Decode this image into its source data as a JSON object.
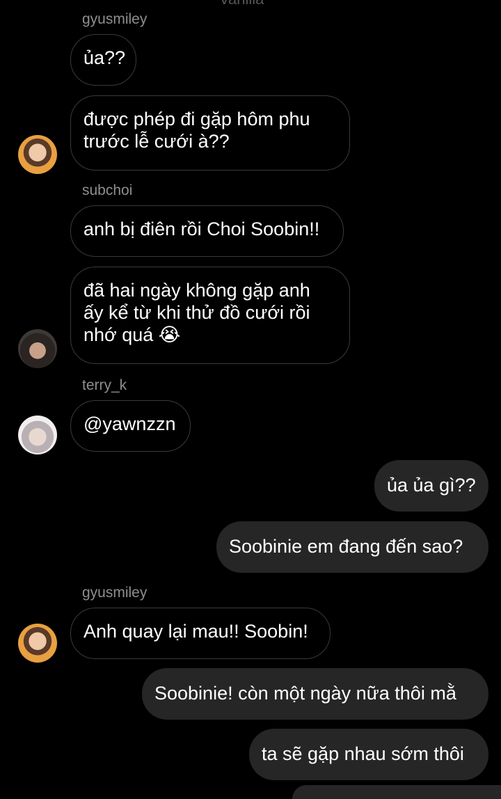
{
  "header_partial": "Vanilla",
  "messages": [
    {
      "username": "gyusmiley"
    },
    {
      "text": "ủa??"
    },
    {
      "text": "được phép đi gặp hôm phu\ntrước lễ cưới à??"
    },
    {
      "username": "subchoi"
    },
    {
      "text": "anh bị điên rồi Choi Soobin!!"
    },
    {
      "text": "đã hai ngày không gặp anh\nấy kể từ khi thử đồ cưới rồi\nnhớ quá 😭"
    },
    {
      "username": "terry_k"
    },
    {
      "text": "@yawnzzn"
    },
    {
      "text": "ủa ủa gì??"
    },
    {
      "text": "Soobinie em đang đến sao?"
    },
    {
      "username": "gyusmiley"
    },
    {
      "text": "Anh quay lại mau!! Soobin!"
    },
    {
      "text": "Soobinie! còn một ngày nữa thôi mằ"
    },
    {
      "text": "ta sẽ gặp nhau sớm thôi"
    }
  ]
}
